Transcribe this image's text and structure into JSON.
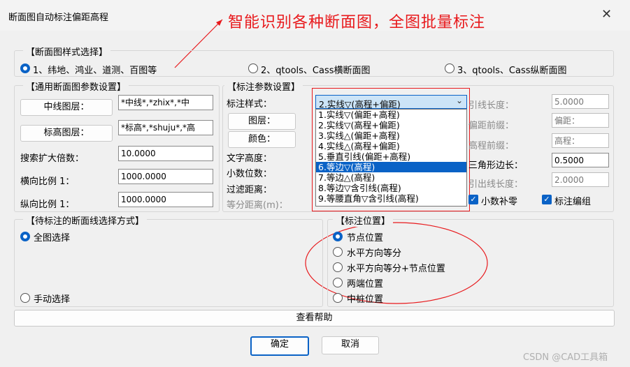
{
  "window": {
    "title": "断面图自动标注偏距高程",
    "close_icon": "close-icon"
  },
  "annotation": {
    "text": "智能识别各种断面图，全图批量标注",
    "color": "#e8191c"
  },
  "style_select": {
    "title": "【断面图样式选择】",
    "options": [
      "1、纬地、鸿业、道测、百图等",
      "2、qtools、Cass横断面图",
      "3、qtools、Cass纵断面图"
    ],
    "selected": 0
  },
  "general": {
    "title": "【通用断面图参数设置】",
    "centerline_btn": "中线图层：",
    "centerline_value": "*中线*,*zhix*,*中",
    "elev_btn": "标高图层：",
    "elev_value": "*标高*,*shuju*,*高",
    "search_label": "搜索扩大倍数：",
    "search_value": "10.0000",
    "hscale_label": "横向比例 1：",
    "hscale_value": "1000.0000",
    "vscale_label": "纵向比例 1：",
    "vscale_value": "1000.0000"
  },
  "label_params": {
    "title": "【标注参数设置】",
    "style_label": "标注样式：",
    "style_value": "2.实线▽(高程+偏距)",
    "layer_btn": "图层：",
    "color_btn": "颜色：",
    "text_height_label": "文字高度：",
    "decimals_label": "小数位数：",
    "filter_label": "过滤距离：",
    "equal_label": "等分距离(m)：",
    "dropdown_items": [
      "1.实线▽(偏距+高程)",
      "2.实线▽(高程+偏距)",
      "3.实线△(偏距+高程)",
      "4.实线△(高程+偏距)",
      "5.垂直引线(偏距+高程)",
      "6.等边▽(高程)",
      "7.等边△(高程)",
      "8.等边▽含引线(高程)",
      "9.等腰直角▽含引线(高程)"
    ],
    "dropdown_selected": 5,
    "leader_len_label": "引线长度：",
    "leader_len_value": "5.0000",
    "offset_prefix_label": "偏距前缀：",
    "offset_prefix_value": "偏距：",
    "elev_prefix_label": "高程前缀：",
    "elev_prefix_value": "高程：",
    "tri_label": "三角形边长：",
    "tri_value": "0.5000",
    "extend_label": "引出线长度：",
    "extend_value": "2.0000",
    "zero_pad_label": "小数补零",
    "group_label": "标注编组"
  },
  "selection": {
    "title": "【待标注的断面线选择方式】",
    "all_label": "全图选择",
    "manual_label": "手动选择"
  },
  "position": {
    "title": "【标注位置】",
    "options": [
      "节点位置",
      "水平方向等分",
      "水平方向等分+节点位置",
      "两端位置",
      "中桩位置"
    ],
    "selected": 0
  },
  "help_btn": "查看帮助",
  "ok_btn": "确定",
  "cancel_btn": "取消",
  "watermark": "CSDN @CAD工具箱"
}
